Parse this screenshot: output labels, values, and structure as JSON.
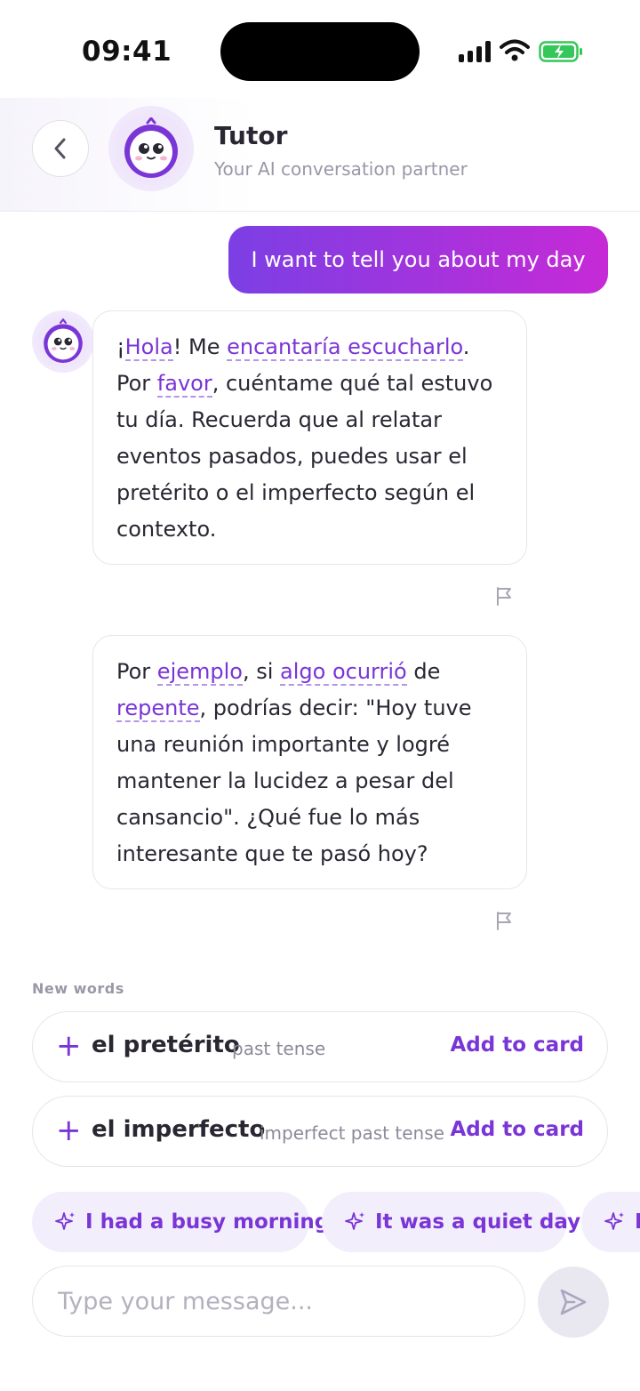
{
  "status_bar": {
    "time": "09:41"
  },
  "header": {
    "title": "Tutor",
    "subtitle": "Your AI conversation partner",
    "back_icon": "chevron-left-icon",
    "avatar_icon": "tutor-mascot-icon"
  },
  "messages": {
    "user": "I want to tell you about my day",
    "bot_1": {
      "p1": "¡",
      "w1": "Hola",
      "p2": "! Me ",
      "w2": "encantaría escucharlo",
      "p3": ". Por ",
      "w3": "favor",
      "p4": ", cuéntame qué tal estuvo tu día. Recuerda que al relatar eventos pasados, puedes usar el pretérito o el imperfecto según el contexto."
    },
    "bot_2": {
      "p1": "Por ",
      "w1": "ejemplo",
      "p2": ", si ",
      "w2": "algo ocurrió",
      "p3": " de ",
      "w3": "repente",
      "p4": ", podrías decir: \"Hoy tuve una reunión importante y logré mantener la lucidez a pesar del cansancio\". ¿Qué fue lo más interesante que te pasó hoy?"
    }
  },
  "new_words": {
    "title": "New words",
    "items": [
      {
        "word": "el pretérito",
        "meaning": "past tense",
        "action": "Add to card"
      },
      {
        "word": "el imperfecto",
        "meaning": "imperfect past tense",
        "action": "Add to card"
      }
    ]
  },
  "suggestions": [
    "I had a busy morning",
    "It was a quiet day",
    "I"
  ],
  "composer": {
    "placeholder": "Type your message...",
    "send_icon": "send-icon"
  },
  "colors": {
    "accent": "#7a35d6",
    "gradient_start": "#7b3fe4",
    "gradient_end": "#c62ad6",
    "battery": "#34c759"
  }
}
